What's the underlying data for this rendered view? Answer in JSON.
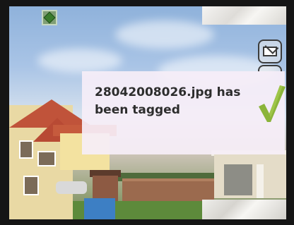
{
  "notification": {
    "message_line1": "28042008026.jpg has",
    "message_line2": "been tagged",
    "status_icon": "checkmark-icon"
  },
  "toolbar": {
    "share_icon": "envelope-icon",
    "tag_icon": "green-tag-icon"
  },
  "colors": {
    "check": "#8bb43a",
    "dialog_bg": "#f6eef7",
    "text": "#2d2d2d"
  }
}
